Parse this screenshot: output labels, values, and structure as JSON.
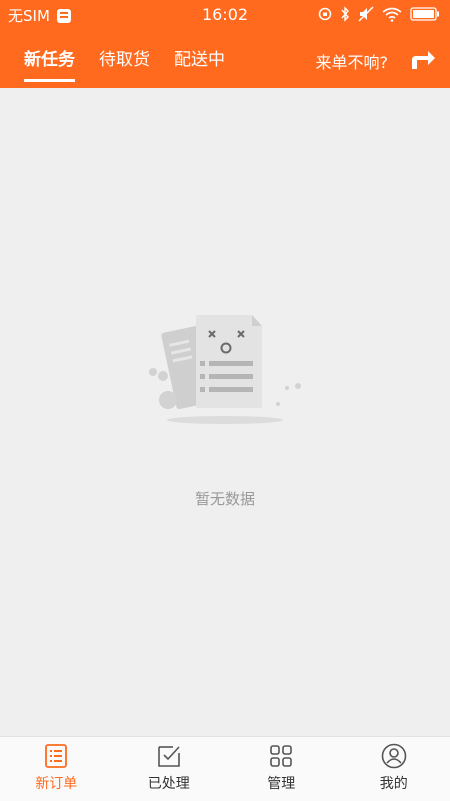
{
  "status_bar": {
    "carrier": "无SIM",
    "time": "16:02"
  },
  "header": {
    "tabs": [
      {
        "label": "新任务",
        "active": true
      },
      {
        "label": "待取货",
        "active": false
      },
      {
        "label": "配送中",
        "active": false
      }
    ],
    "help_label": "来单不响?",
    "accent_color": "#ff6a1f"
  },
  "empty_state": {
    "message": "暂无数据"
  },
  "bottom_nav": {
    "items": [
      {
        "label": "新订单",
        "icon": "order-list-icon",
        "active": true
      },
      {
        "label": "已处理",
        "icon": "processed-icon",
        "active": false
      },
      {
        "label": "管理",
        "icon": "grid-icon",
        "active": false
      },
      {
        "label": "我的",
        "icon": "user-icon",
        "active": false
      }
    ]
  }
}
